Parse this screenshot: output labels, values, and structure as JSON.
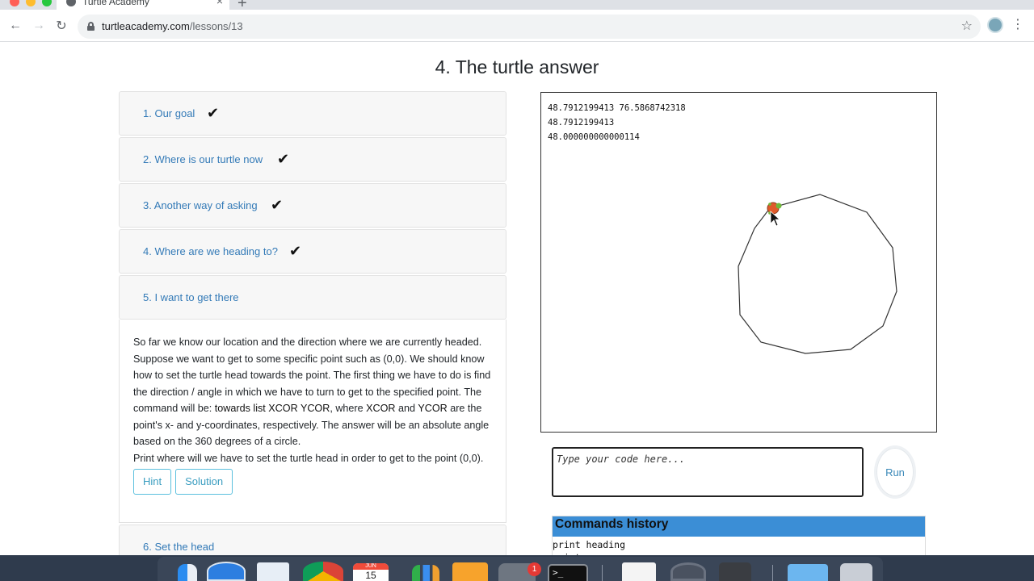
{
  "browser": {
    "tab_title": "Turtle Academy",
    "new_tab": "+",
    "tab_close": "×",
    "url_host": "turtleacademy.com",
    "url_path": "/lessons/13",
    "back": "←",
    "forward": "→",
    "reload": "↻",
    "star": "☆",
    "menu": "⋮",
    "colors": {
      "close": "#ff5f57",
      "minimize": "#febc2e",
      "zoom": "#28c840"
    }
  },
  "page": {
    "title": "4. The turtle answer"
  },
  "lessons": {
    "check": "✔",
    "items": [
      {
        "label": "1. Our goal",
        "done": true
      },
      {
        "label": "2. Where is our turtle now",
        "done": true
      },
      {
        "label": "3. Another way of asking",
        "done": true
      },
      {
        "label": "4. Where are we heading to?",
        "done": true
      },
      {
        "label": "5. I want to get there",
        "done": false
      },
      {
        "label": "6. Set the head",
        "done": false
      }
    ],
    "active_body": {
      "p1_a": "So far we know our location and the direction where we are currently headed. Suppose we want to get to some specific point such as (0,0). We should know how to set the turtle head towards the point. The first thing we have to do is find the direction / angle in which we have to turn to get to the specified point. The command will be: ",
      "p1_cmd": "towards list XCOR YCOR",
      "p1_b": ", where ",
      "p1_x": "XCOR",
      "p1_c": " and ",
      "p1_y": "YCOR",
      "p1_d": " are the point's x- and y-coordinates, respectively. The answer will be an absolute angle based on the 360 degrees of a circle.",
      "p2": "Print where will we have to set the turtle head in order to get to the point (0,0).",
      "hint_label": "Hint",
      "solution_label": "Solution"
    }
  },
  "console": {
    "output_lines": [
      "48.7912199413 76.5868742318",
      "48.7912199413",
      "48.000000000000114"
    ]
  },
  "editor": {
    "placeholder": "Type your code here...",
    "run_label": "Run"
  },
  "history": {
    "title": "Commands history",
    "items": [
      "print heading",
      "print ..."
    ]
  },
  "dock": {
    "badge_count": "1",
    "apps": [
      "finder-icon",
      "safari-icon",
      "mail-icon",
      "chrome-icon",
      "calendar-icon",
      "numbers-icon",
      "pages-icon",
      "system-preferences-icon",
      "terminal-icon",
      "textedit-icon",
      "quicktime-icon",
      "calculator-icon",
      "downloads-folder-icon",
      "trash-icon"
    ],
    "calendar_month": "JUN",
    "calendar_day": "15",
    "terminal_prompt": ">_"
  }
}
